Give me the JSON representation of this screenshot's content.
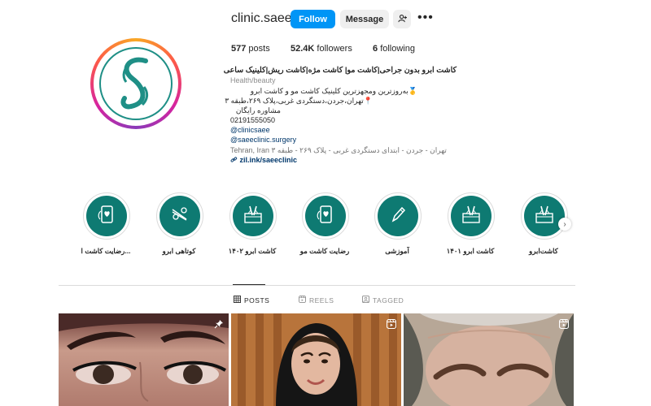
{
  "profile": {
    "username": "clinic.saee",
    "follow_label": "Follow",
    "message_label": "Message",
    "posts_count": "577",
    "posts_label": "posts",
    "followers_count": "52.4K",
    "followers_label": "followers",
    "following_count": "6",
    "following_label": "following"
  },
  "bio": {
    "name": "کاشت ابرو بدون جراحی|کاشت مو| کاشت مژه|کاشت ریش|کلینیک ساعی",
    "category": "Health/beauty",
    "line1": "🥇به‌روزترین ومجهزترین کلینیک کاشت مو و کاشت ابرو",
    "line2": "📍تهران،جردن،دستگردی غربی،پلاک ۲۶۹،طبقه ۳",
    "line3": "مشاوره رایگان",
    "phone": "02191555050",
    "handle1": "@clinicsaee",
    "handle2": "@saeeclinic.surgery",
    "address_prefix": "Tehran, Iran",
    "address": "تهران - جردن - ابتدای دستگردی غربی - پلاک ۲۶۹ - طبقه ۳",
    "link": "zil.ink/saeeclinic"
  },
  "highlights": [
    {
      "label": "کاشت‌ابرو",
      "icon": "eyebrow-implant-icon"
    },
    {
      "label": "کاشت ابرو ۱۴۰۱",
      "icon": "eyebrow-implant-icon"
    },
    {
      "label": "آموزشی",
      "icon": "pencil-icon"
    },
    {
      "label": "رضایت کاشت مو",
      "icon": "phone-heart-icon"
    },
    {
      "label": "کاشت ابرو ۱۴۰۲",
      "icon": "eyebrow-implant-icon"
    },
    {
      "label": "کوتاهی ابرو",
      "icon": "tweezers-icon"
    },
    {
      "label": "رضایت کاشت ا...",
      "icon": "phone-heart-icon"
    }
  ],
  "tabs": {
    "posts": "POSTS",
    "reels": "REELS",
    "tagged": "TAGGED"
  },
  "colors": {
    "accent": "#0095f6",
    "highlight_bg": "#0e7a72",
    "logo": "#1f8f86"
  }
}
